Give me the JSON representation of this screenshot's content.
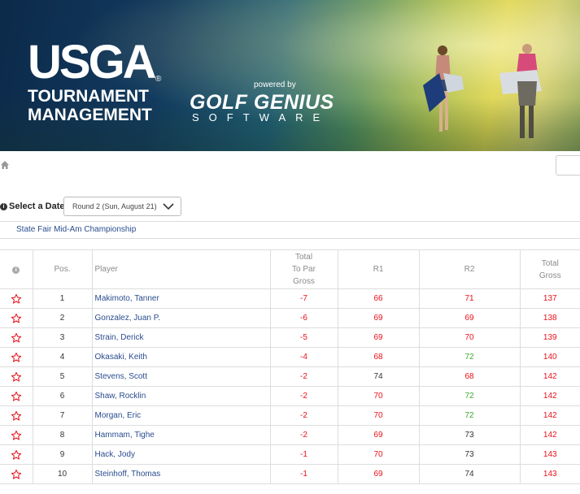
{
  "banner": {
    "brand": "USGA",
    "brand_mark": "®",
    "title_line1": "TOURNAMENT",
    "title_line2": "MANAGEMENT",
    "powered_by": "powered by",
    "sponsor_line1": "GOLF GENIUS",
    "sponsor_line2": "SOFTWARE"
  },
  "date_select": {
    "label": "Select a Date:",
    "value": "Round 2 (Sun, August 21)"
  },
  "tournament_name": "State Fair Mid-Am Championship",
  "icons": {
    "home": "home-icon",
    "info": "info-icon",
    "star": "star-outline-icon"
  },
  "colors": {
    "under_par": "#e8121b",
    "green": "#3bab2f",
    "link": "#2a4d8f"
  },
  "table": {
    "headers": {
      "info": "i",
      "pos": "Pos.",
      "player": "Player",
      "total_to_par_1": "Total",
      "total_to_par_2": "To Par",
      "total_to_par_3": "Gross",
      "r1": "R1",
      "r2": "R2",
      "total_gross_1": "Total",
      "total_gross_2": "Gross"
    },
    "rows": [
      {
        "pos": "1",
        "player": "Makimoto, Tanner",
        "to_par": "-7",
        "r1": "66",
        "r1_color": "red",
        "r2": "71",
        "r2_color": "red",
        "total": "137"
      },
      {
        "pos": "2",
        "player": "Gonzalez, Juan P.",
        "to_par": "-6",
        "r1": "69",
        "r1_color": "red",
        "r2": "69",
        "r2_color": "red",
        "total": "138"
      },
      {
        "pos": "3",
        "player": "Strain, Derick",
        "to_par": "-5",
        "r1": "69",
        "r1_color": "red",
        "r2": "70",
        "r2_color": "red",
        "total": "139"
      },
      {
        "pos": "4",
        "player": "Okasaki, Keith",
        "to_par": "-4",
        "r1": "68",
        "r1_color": "red",
        "r2": "72",
        "r2_color": "green",
        "total": "140"
      },
      {
        "pos": "5",
        "player": "Stevens, Scott",
        "to_par": "-2",
        "r1": "74",
        "r1_color": "black",
        "r2": "68",
        "r2_color": "red",
        "total": "142"
      },
      {
        "pos": "6",
        "player": "Shaw, Rocklin",
        "to_par": "-2",
        "r1": "70",
        "r1_color": "red",
        "r2": "72",
        "r2_color": "green",
        "total": "142"
      },
      {
        "pos": "7",
        "player": "Morgan, Eric",
        "to_par": "-2",
        "r1": "70",
        "r1_color": "red",
        "r2": "72",
        "r2_color": "green",
        "total": "142"
      },
      {
        "pos": "8",
        "player": "Hammam, Tighe",
        "to_par": "-2",
        "r1": "69",
        "r1_color": "red",
        "r2": "73",
        "r2_color": "black",
        "total": "142"
      },
      {
        "pos": "9",
        "player": "Hack, Jody",
        "to_par": "-1",
        "r1": "70",
        "r1_color": "red",
        "r2": "73",
        "r2_color": "black",
        "total": "143"
      },
      {
        "pos": "10",
        "player": "Steinhoff, Thomas",
        "to_par": "-1",
        "r1": "69",
        "r1_color": "red",
        "r2": "74",
        "r2_color": "black",
        "total": "143"
      }
    ]
  }
}
